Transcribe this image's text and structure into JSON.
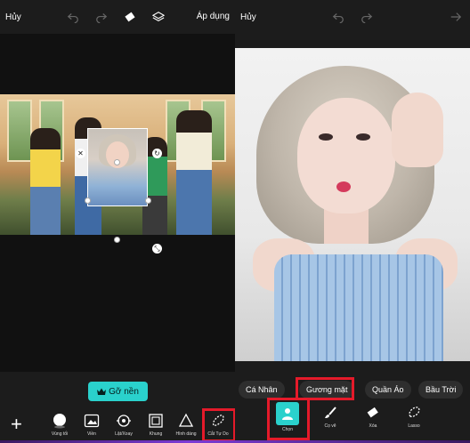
{
  "left": {
    "cancel_label": "Hủy",
    "apply_label": "Áp dụng",
    "remove_bg_label": "Gỡ nền",
    "tools": [
      {
        "label": "Vùng tối",
        "icon": "shadow-icon"
      },
      {
        "label": "Viền",
        "icon": "border-icon"
      },
      {
        "label": "Lật/Xoay",
        "icon": "flip-rotate-icon"
      },
      {
        "label": "Khung",
        "icon": "frame-icon"
      },
      {
        "label": "Hình dáng",
        "icon": "shape-icon"
      },
      {
        "label": "Cắt Tự Do",
        "icon": "freecut-icon"
      }
    ]
  },
  "right": {
    "cancel_label": "Hủy",
    "chips": [
      "Cá Nhân",
      "Gương mặt",
      "Quần Áo",
      "Bầu Trời"
    ],
    "tools": [
      {
        "label": "Chọn",
        "icon": "person-select-icon"
      },
      {
        "label": "Cọ vẽ",
        "icon": "brush-icon"
      },
      {
        "label": "Xóa",
        "icon": "eraser-icon"
      },
      {
        "label": "Lasso",
        "icon": "lasso-icon"
      }
    ]
  },
  "colors": {
    "accent": "#2ad1cc",
    "highlight": "#e51a2a",
    "background": "#1c1c1c"
  }
}
